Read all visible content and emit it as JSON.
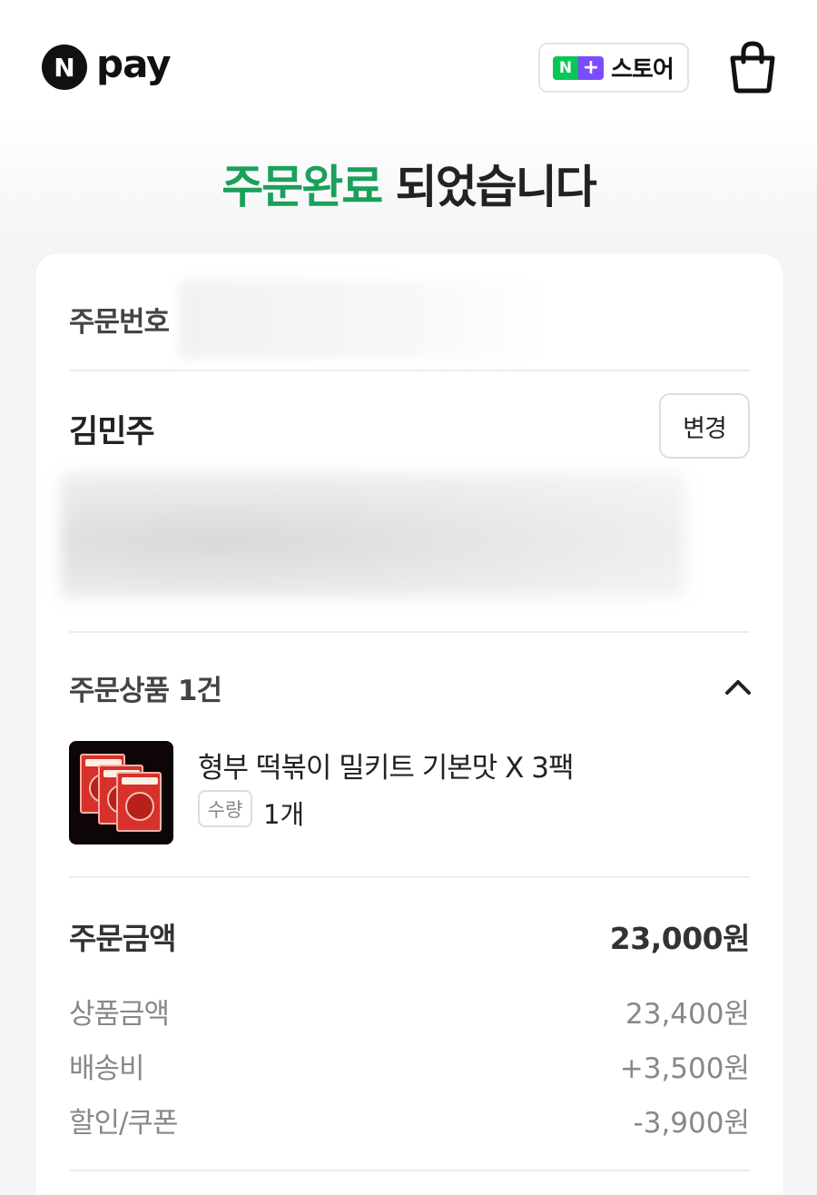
{
  "header": {
    "logo_mark": "N",
    "logo_text": "pay",
    "store_mark_n": "N",
    "store_mark_plus": "+",
    "store_label": "스토어",
    "cart_icon": "shopping-bag-icon"
  },
  "title": {
    "accent": "주문완료",
    "rest": " 되었습니다"
  },
  "order": {
    "number_label": "주문번호"
  },
  "recipient": {
    "name": "김민주",
    "change_label": "변경"
  },
  "products": {
    "heading": "주문상품 1건",
    "items": [
      {
        "name": "형부 떡볶이 밀키트 기본맛 X 3팩",
        "qty_label": "수량",
        "qty_value": "1개"
      }
    ]
  },
  "summary": {
    "total_label": "주문금액",
    "total_value": "23,000원",
    "rows": [
      {
        "label": "상품금액",
        "value": "23,400원"
      },
      {
        "label": "배송비",
        "value": "+3,500원"
      },
      {
        "label": "할인/쿠폰",
        "value": "-3,900원"
      }
    ]
  },
  "colors": {
    "accent": "#1ba05a",
    "naver_green": "#06c755",
    "naver_purple": "#7b4dff"
  }
}
